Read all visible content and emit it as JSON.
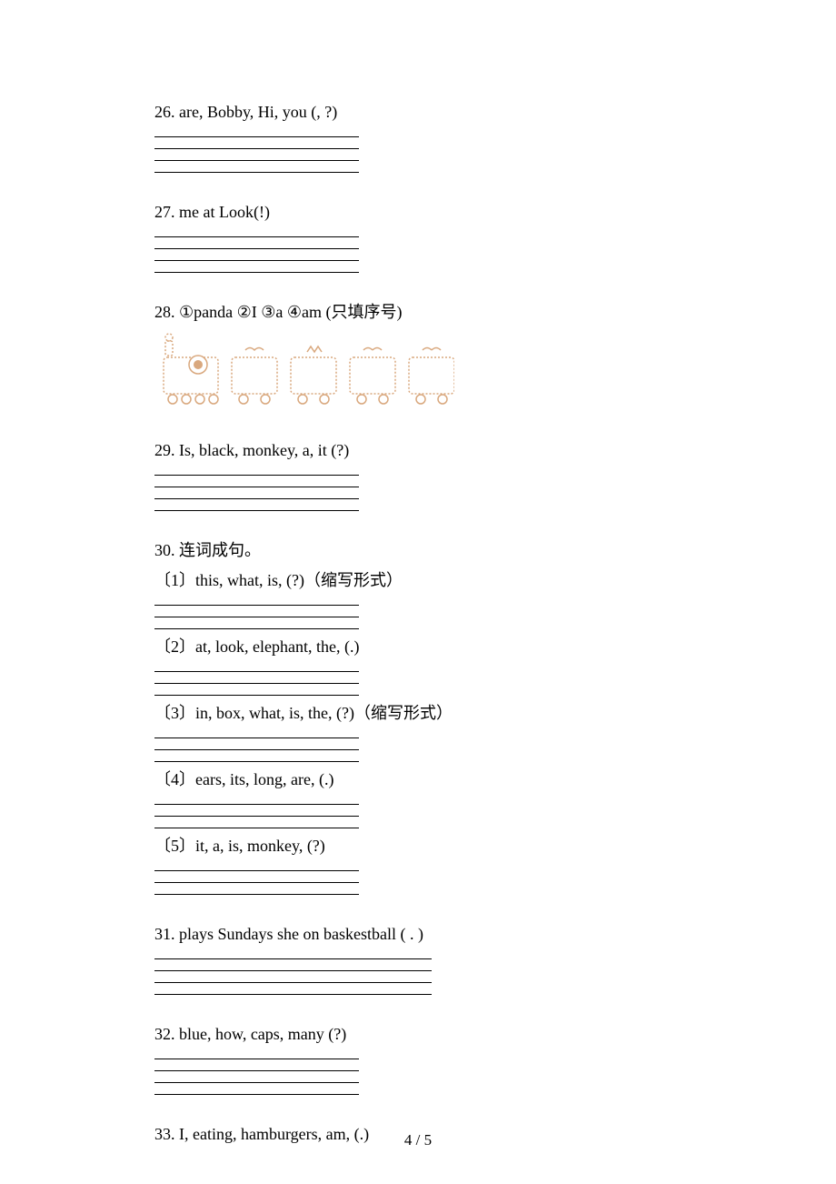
{
  "q26": {
    "num": "26.",
    "text": " are, Bobby, Hi, you (, ?)"
  },
  "q27": {
    "num": "27.",
    "text": " me at   Look(!)"
  },
  "q28": {
    "num": "28.",
    "text": " ①panda   ②I ③a   ④am  (只填序号)"
  },
  "q29": {
    "num": "29.",
    "text": " Is, black, monkey, a, it (?)"
  },
  "q30": {
    "num": "30.",
    "title": " 连词成句。",
    "sub1": "〔1〕this, what, is, (?)（缩写形式）",
    "sub2": "〔2〕at, look, elephant, the, (.)",
    "sub3": "〔3〕in, box, what, is, the, (?)（缩写形式）",
    "sub4": "〔4〕ears, its, long, are, (.)",
    "sub5": "〔5〕it, a, is, monkey, (?)"
  },
  "q31": {
    "num": "31.",
    "text": " plays  Sundays she  on  baskestball ( . )"
  },
  "q32": {
    "num": "32.",
    "text": " blue, how, caps, many (?)"
  },
  "q33": {
    "num": "33.",
    "text": " I, eating, hamburgers, am, (.)"
  },
  "page": "4 / 5"
}
